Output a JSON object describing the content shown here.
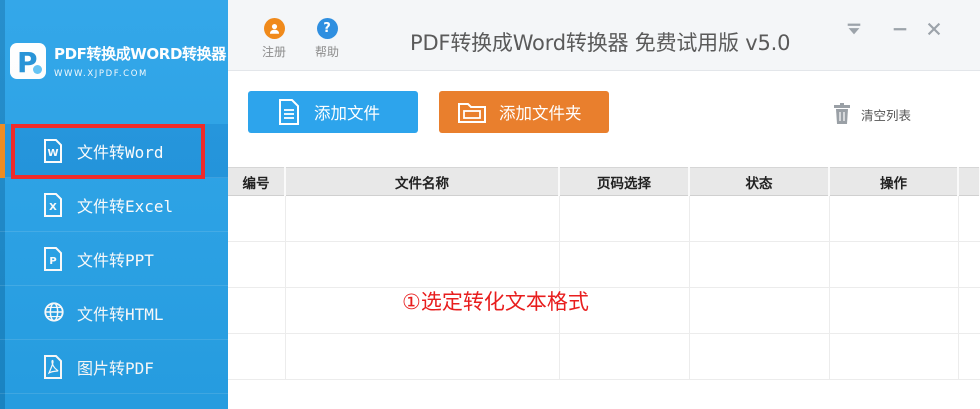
{
  "app": {
    "title": "PDF转换成Word转换器 免费试用版 v5.0",
    "brand_title": "PDF转换成WORD转换器",
    "brand_site": "WWW.XJPDF.COM"
  },
  "titlebar": {
    "register_label": "注册",
    "help_label": "帮助",
    "help_glyph": "?"
  },
  "sidebar": {
    "items": [
      {
        "label": "文件转Word",
        "icon": "word-doc-icon",
        "glyph": "W"
      },
      {
        "label": "文件转Excel",
        "icon": "excel-doc-icon",
        "glyph": "X"
      },
      {
        "label": "文件转PPT",
        "icon": "ppt-doc-icon",
        "glyph": "P"
      },
      {
        "label": "文件转HTML",
        "icon": "globe-icon",
        "glyph": ""
      },
      {
        "label": "图片转PDF",
        "icon": "pdf-doc-icon",
        "glyph": ""
      }
    ],
    "active_index": 0
  },
  "toolbar": {
    "add_file_label": "添加文件",
    "add_folder_label": "添加文件夹",
    "clear_list_label": "清空列表"
  },
  "table": {
    "columns": [
      "编号",
      "文件名称",
      "页码选择",
      "状态",
      "操作"
    ]
  },
  "annotation": {
    "text": "①选定转化文本格式"
  },
  "colors": {
    "sidebar": "#27a2e8",
    "add_file_button": "#2da4ec",
    "add_folder_button": "#e97f2d",
    "highlight": "#ef2b2b",
    "annotation": "#e81e1e",
    "register_icon": "#f08a1b",
    "help_icon": "#2f8fe0"
  }
}
